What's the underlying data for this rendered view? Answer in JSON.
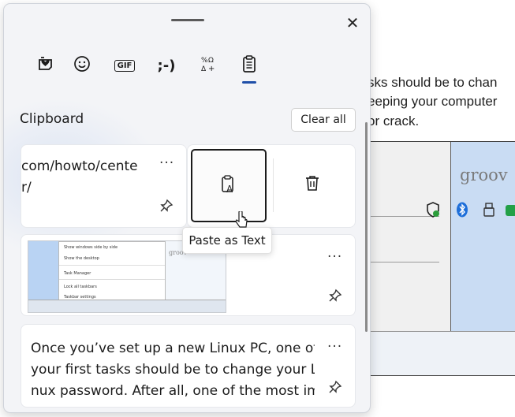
{
  "background": {
    "text_lines": [
      "sks should be to chan",
      "eeping your computer",
      "or crack."
    ],
    "site_logo_text": "groov"
  },
  "panel": {
    "close_glyph": "✕",
    "tabs": [
      {
        "name": "heart-sticker-icon"
      },
      {
        "name": "smiley-icon"
      },
      {
        "name": "gif-icon",
        "label": "GIF"
      },
      {
        "name": "kaomoji-icon",
        "label": ";-)"
      },
      {
        "name": "symbols-icon"
      },
      {
        "name": "clipboard-icon",
        "selected": true
      }
    ],
    "section_title": "Clipboard",
    "clear_all_label": "Clear all",
    "more_glyph": "···",
    "items": [
      {
        "type": "text",
        "lines": [
          "com/howto/cente",
          "r/"
        ]
      },
      {
        "type": "image",
        "thumb_menu": [
          "Show windows side by side",
          "Show the desktop",
          "Task Manager",
          "Lock all taskbars",
          "Taskbar settings"
        ],
        "thumb_logo": "groov"
      },
      {
        "type": "text",
        "lines": [
          "Once you’ve set up a new Linux PC, one of",
          "your first tasks should be to change your Li",
          "nux password. After all, one of the most im"
        ]
      }
    ],
    "tooltip": "Paste as Text"
  }
}
